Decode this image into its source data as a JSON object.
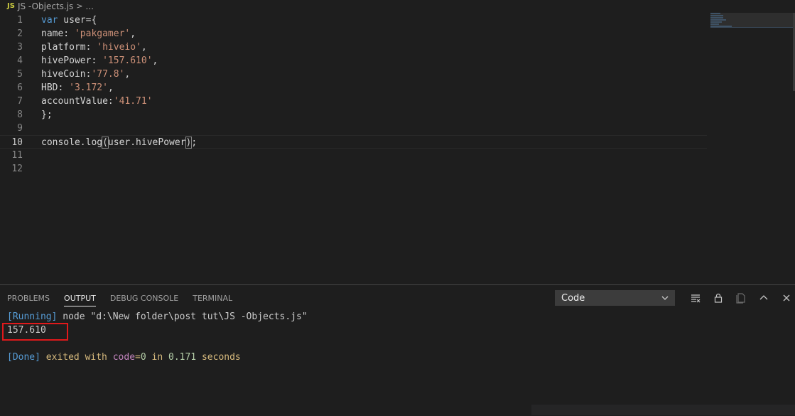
{
  "breadcrumb": {
    "file_badge": "JS",
    "file_name": "JS -Objects.js",
    "separator": ">",
    "ellipsis": "..."
  },
  "editor": {
    "lines": [
      {
        "n": "1",
        "tokens": [
          {
            "t": "var",
            "c": "kw"
          },
          {
            "t": " user={",
            "c": "plain"
          }
        ]
      },
      {
        "n": "2",
        "tokens": [
          {
            "t": "name: ",
            "c": "plain"
          },
          {
            "t": "'pakgamer'",
            "c": "str"
          },
          {
            "t": ",",
            "c": "plain"
          }
        ]
      },
      {
        "n": "3",
        "tokens": [
          {
            "t": "platform: ",
            "c": "plain"
          },
          {
            "t": "'hiveio'",
            "c": "str"
          },
          {
            "t": ",",
            "c": "plain"
          }
        ]
      },
      {
        "n": "4",
        "tokens": [
          {
            "t": "hivePower: ",
            "c": "plain"
          },
          {
            "t": "'157.610'",
            "c": "str"
          },
          {
            "t": ",",
            "c": "plain"
          }
        ]
      },
      {
        "n": "5",
        "tokens": [
          {
            "t": "hiveCoin:",
            "c": "plain"
          },
          {
            "t": "'77.8'",
            "c": "str"
          },
          {
            "t": ",",
            "c": "plain"
          }
        ]
      },
      {
        "n": "6",
        "tokens": [
          {
            "t": "HBD: ",
            "c": "plain"
          },
          {
            "t": "'3.172'",
            "c": "str"
          },
          {
            "t": ",",
            "c": "plain"
          }
        ]
      },
      {
        "n": "7",
        "tokens": [
          {
            "t": "accountValue:",
            "c": "plain"
          },
          {
            "t": "'41.71'",
            "c": "str"
          }
        ]
      },
      {
        "n": "8",
        "tokens": [
          {
            "t": "};",
            "c": "plain"
          }
        ]
      },
      {
        "n": "9",
        "tokens": []
      },
      {
        "n": "10",
        "tokens": [
          {
            "t": "console.log",
            "c": "plain"
          },
          {
            "t": "(",
            "c": "bm"
          },
          {
            "t": "user.hivePower",
            "c": "plain"
          },
          {
            "t": ")",
            "c": "bm"
          },
          {
            "t": ";",
            "c": "plain"
          }
        ]
      },
      {
        "n": "11",
        "tokens": []
      },
      {
        "n": "12",
        "tokens": []
      }
    ],
    "current_line": "10"
  },
  "panel": {
    "tabs": [
      "PROBLEMS",
      "OUTPUT",
      "DEBUG CONSOLE",
      "TERMINAL"
    ],
    "active_tab": "OUTPUT",
    "channel_select": "Code",
    "output": {
      "running_tag": "[Running]",
      "running_cmd": " node \"d:\\New folder\\post tut\\JS -Objects.js\"",
      "result": "157.610",
      "done_tag": "[Done]",
      "done_text_1": " exited with ",
      "done_code_kw": "code",
      "done_eq": "=",
      "done_code_val": "0",
      "done_in": " in ",
      "done_time": "0.171",
      "done_seconds": " seconds"
    }
  },
  "colors": {
    "background": "#1e1e1e",
    "highlight_border": "#e0191b"
  }
}
